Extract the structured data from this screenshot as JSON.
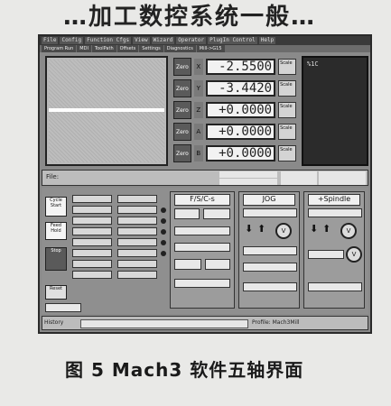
{
  "header_fragment": "…加工数控系统一般…",
  "menubar": {
    "items": [
      "File",
      "Config",
      "Function Cfgs",
      "View",
      "Wizard",
      "Operator",
      "PlugIn Control",
      "Help"
    ]
  },
  "tabs": [
    "Program Run",
    "MDI",
    "ToolPath",
    "Offsets",
    "Settings",
    "Diagnostics",
    "Mill->G15"
  ],
  "toolpath": {
    "label": ""
  },
  "axes": [
    {
      "zero": "Zero",
      "label": "X",
      "value": "-2.5500",
      "scale": "Scale"
    },
    {
      "zero": "Zero",
      "label": "Y",
      "value": "-3.4420",
      "scale": "Scale"
    },
    {
      "zero": "Zero",
      "label": "Z",
      "value": "+0.0000",
      "scale": "Scale"
    },
    {
      "zero": "Zero",
      "label": "A",
      "value": "+0.0000",
      "scale": "Scale"
    },
    {
      "zero": "Zero",
      "label": "B",
      "value": "+0.0000",
      "scale": "Scale"
    }
  ],
  "gcode": {
    "text": "%1C"
  },
  "strip": {
    "file_label": "File:"
  },
  "left_buttons": [
    "Cycle Start",
    "Feed Hold",
    "Stop",
    "Reset"
  ],
  "sections": [
    {
      "title": "F/S/C-s"
    },
    {
      "title": "JOG"
    },
    {
      "title": "+Spindle"
    }
  ],
  "knob_label": "V",
  "status": {
    "history": "History",
    "profile": "Profile: Mach3Mill"
  },
  "caption": "图 5   Mach3 软件五轴界面",
  "colors": {
    "frame": "#2a2a2a",
    "panel": "#8a8a8a",
    "dro_bg": "#f2f2f2",
    "code_bg": "#2b2b2b"
  }
}
